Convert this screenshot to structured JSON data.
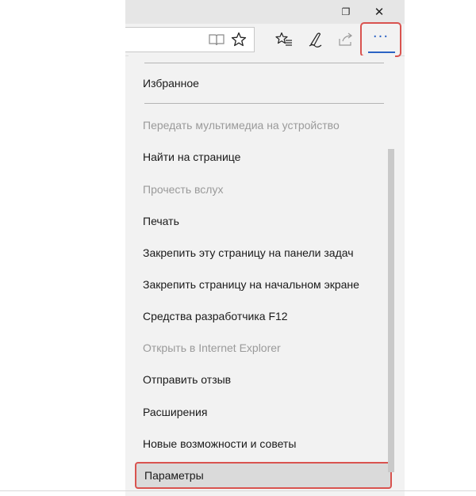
{
  "window_controls": {
    "restore_glyph": "❐",
    "close_glyph": "✕"
  },
  "toolbar": {
    "icons": [
      "reading-view-icon",
      "favorite-star-icon",
      "favorites-hub-icon",
      "web-note-icon",
      "share-icon"
    ],
    "more_glyph": "···"
  },
  "menu": {
    "items": [
      {
        "label": "Избранное",
        "enabled": true
      },
      {
        "label": "Передать мультимедиа на устройство",
        "enabled": false
      },
      {
        "label": "Найти на странице",
        "enabled": true
      },
      {
        "label": "Прочесть вслух",
        "enabled": false
      },
      {
        "label": "Печать",
        "enabled": true
      },
      {
        "label": "Закрепить эту страницу на панели задач",
        "enabled": true
      },
      {
        "label": "Закрепить страницу на начальном экране",
        "enabled": true
      },
      {
        "label": "Средства разработчика F12",
        "enabled": true
      },
      {
        "label": "Открыть в Internet Explorer",
        "enabled": false
      },
      {
        "label": "Отправить отзыв",
        "enabled": true
      },
      {
        "label": "Расширения",
        "enabled": true
      },
      {
        "label": "Новые возможности и советы",
        "enabled": true
      },
      {
        "label": "Параметры",
        "enabled": true,
        "highlighted": true
      }
    ]
  },
  "colors": {
    "highlight_border": "#d9534f",
    "accent": "#2b63c4",
    "disabled_text": "#9a9a9a"
  }
}
